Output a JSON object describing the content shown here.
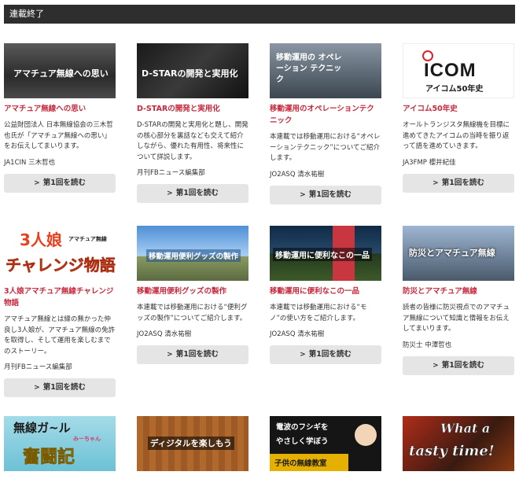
{
  "header": {
    "title": "連載終了"
  },
  "read_label": "第1回を読む",
  "cards": [
    {
      "title": "アマチュア無線への思い",
      "thumb_caption": "アマチュア無線への思い",
      "desc": "公益財団法人 日本無線協会の三木哲也氏が「アマチュア無線への思い」をお伝えしてまいります。",
      "author": "JA1CIN 三木哲也"
    },
    {
      "title": "D-STARの開発と実用化",
      "thumb_caption": "D-STARの開発と実用化",
      "desc": "D-STARの開発と実用化と題し、開発の核心部分を裏話なども交えて紹介しながら、優れた有用性、将来性について詳説します。",
      "author": "月刊FBニュース編集部"
    },
    {
      "title": "移動運用のオペレーションテクニック",
      "thumb_caption": "移動運用の オペレーション テクニック",
      "desc": "本連載では移動運用における“オペレーションテクニック”についてご紹介します。",
      "author": "JO2ASQ 清水祐樹"
    },
    {
      "title": "アイコム50年史",
      "thumb_caption": "ICOM",
      "thumb_sub": "アイコム50年史",
      "desc": "オールトランジスタ無線機を目標に進めてきたアイコムの当時を振り返って語を進めていきます。",
      "author": "JA3FMP 櫻井紀佳"
    },
    {
      "title": "3人娘アマチュア無線チャレンジ物語",
      "thumb_caption": "3人娘",
      "thumb_sub": "チャレンジ物語",
      "thumb_small": "アマチュア無線",
      "desc": "アマチュア無線とは縁の無かった仲良し3人娘が、アマチュア無線の免許を取得し、そして運用を楽しむまでのストーリー。",
      "author": "月刊FBニュース編集部"
    },
    {
      "title": "移動運用便利グッズの製作",
      "thumb_caption": "移動運用便利グッズの製作",
      "desc": "本連載では移動運用における“便利グッズの製作”についてご紹介します。",
      "author": "JO2ASQ 清水祐樹"
    },
    {
      "title": "移動運用に便利なこの一品",
      "thumb_caption": "移動運用に便利なこの一品",
      "desc": "本連載では移動運用における“モノ”の使い方をご紹介します。",
      "author": "JO2ASQ 清水祐樹"
    },
    {
      "title": "防災とアマチュア無線",
      "thumb_caption": "防災とアマチュア無線",
      "desc": "読者の皆様に防災視点でのアマチュア無線について知識と情報をお伝えしてまいります。",
      "author": "防災士 中澤哲也"
    },
    {
      "thumb_caption": "無線ガ~ル",
      "thumb_sub": "奮闘記",
      "thumb_small": "みーちゃん"
    },
    {
      "thumb_caption": "ディジタルを楽しもう"
    },
    {
      "thumb_caption": "電波のフシギを",
      "thumb_sub": "やさしく学ぼう",
      "thumb_small": "子供の無線教室"
    },
    {
      "thumb_caption": "What a",
      "thumb_sub": "tasty time!"
    }
  ]
}
